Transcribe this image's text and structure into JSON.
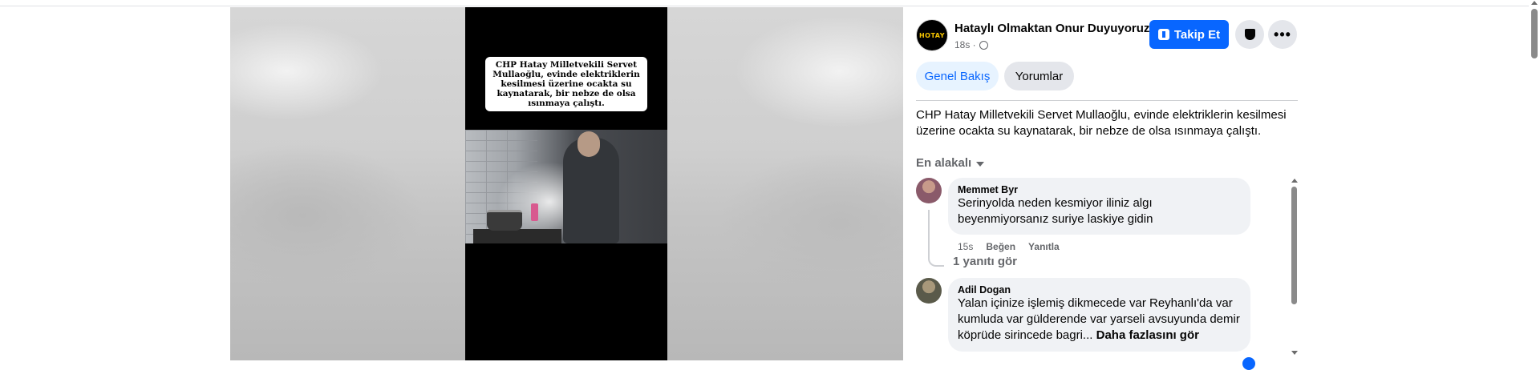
{
  "video": {
    "caption": "CHP Hatay Milletvekili Servet Mullaoğlu, evinde elektriklerin kesilmesi üzerine ocakta su kaynatarak, bir nebze de olsa ısınmaya çalıştı."
  },
  "post": {
    "page_avatar_text": "HOTAY",
    "page_name": "Hataylı Olmaktan Onur Duyuyoruz",
    "time": "18s ·",
    "follow_label": "Takip Et",
    "tabs": [
      {
        "label": "Genel Bakış",
        "active": true
      },
      {
        "label": "Yorumlar",
        "active": false
      }
    ],
    "text": "CHP Hatay Milletvekili Servet Mullaoğlu, evinde elektriklerin kesilmesi üzerine ocakta su kaynatarak, bir nebze de olsa ısınmaya çalıştı."
  },
  "comments": {
    "sort_label": "En alakalı",
    "items": [
      {
        "author": "Memmet Byr",
        "text": "Serinyolda neden kesmiyor iliniz algı beyenmiyorsanız suriye laskiye gidin",
        "time": "15s",
        "like_label": "Beğen",
        "reply_label": "Yanıtla",
        "replies_label": "1 yanıtı gör"
      },
      {
        "author": "Adil Dogan",
        "text": "Yalan içinize işlemiş dikmecede var Reyhanlı'da var kumluda var gülderende var yarseli avsuyunda demir köprüde sirincede bagri...",
        "more_label": "Daha fazlasını gör"
      }
    ]
  },
  "colors": {
    "accent": "#0866ff",
    "tab_active_bg": "#e7f3ff",
    "bubble_bg": "#f0f2f5"
  }
}
